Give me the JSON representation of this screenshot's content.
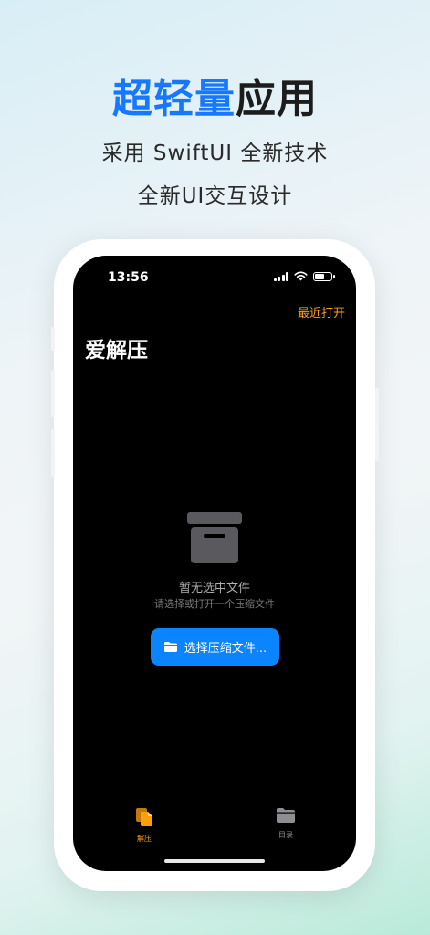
{
  "promo": {
    "headline_blue": "超轻量",
    "headline_dark": "应用",
    "subtitle_line1": "采用 SwiftUI 全新技术",
    "subtitle_line2": "全新UI交互设计"
  },
  "status_bar": {
    "time": "13:56"
  },
  "nav": {
    "recent_link": "最近打开",
    "title": "爱解压"
  },
  "empty_state": {
    "icon": "archive-box-icon",
    "title": "暂无选中文件",
    "subtitle": "请选择或打开一个压缩文件"
  },
  "select_button": {
    "icon": "folder-icon",
    "label": "选择压缩文件..."
  },
  "tab_bar": {
    "tabs": [
      {
        "label": "解压",
        "icon": "documents-icon",
        "selected": true
      },
      {
        "label": "目录",
        "icon": "folder-icon",
        "selected": false
      }
    ]
  },
  "colors": {
    "accent_blue": "#1677ff",
    "button_blue": "#0a84ff",
    "accent_orange": "#ff9f0a"
  }
}
